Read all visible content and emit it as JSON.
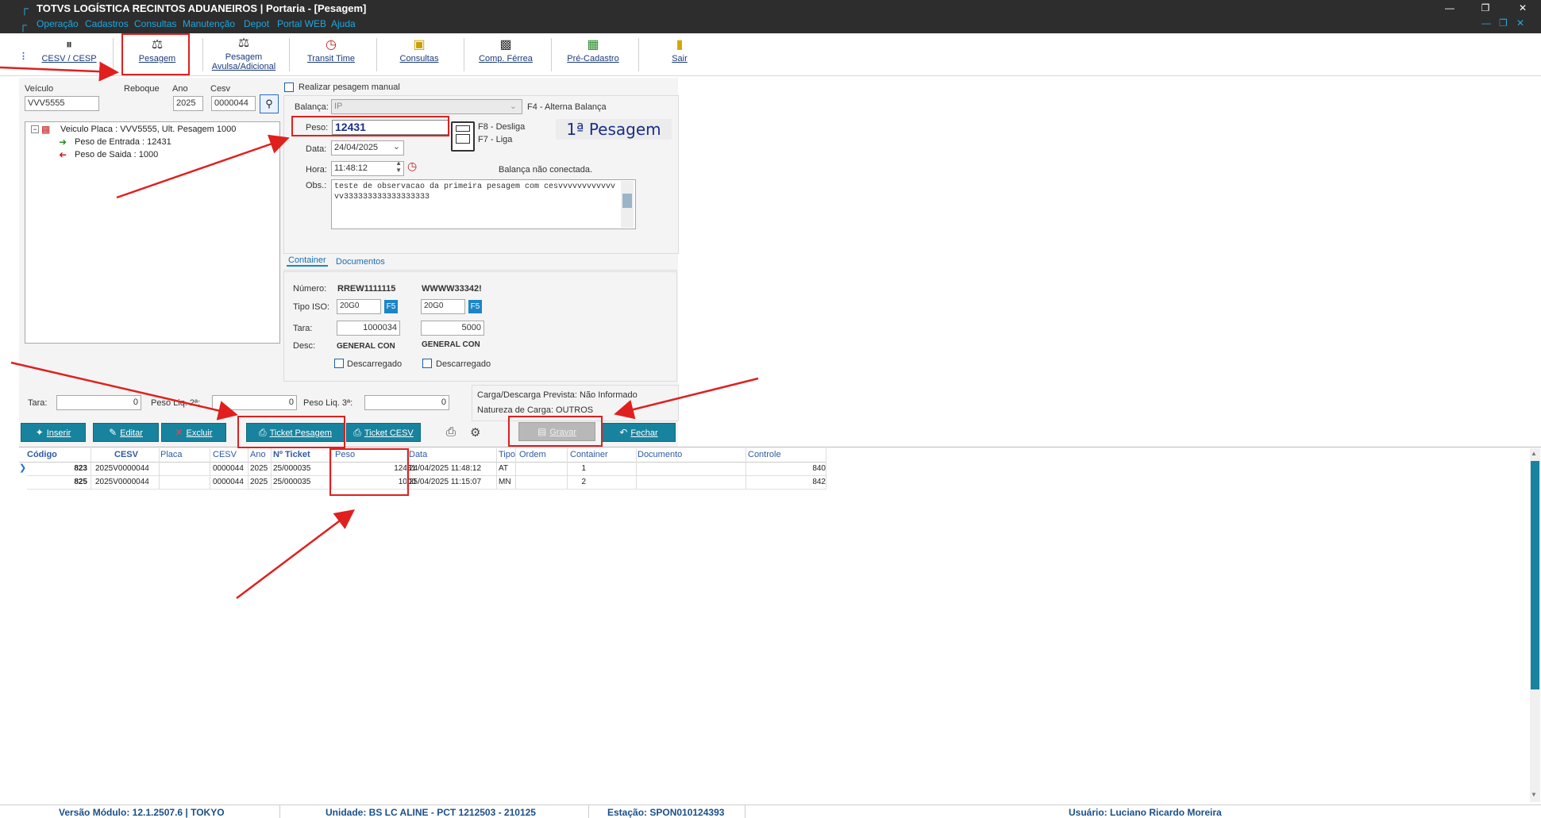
{
  "window": {
    "title": "TOTVS LOGÍSTICA RECINTOS ADUANEIROS | Portaria - [Pesagem]"
  },
  "menu": [
    "Operação",
    "Cadastros",
    "Consultas",
    "Manutenção",
    "Depot",
    "Portal WEB",
    "Ajuda"
  ],
  "toolbar": {
    "cesv": "CESV / CESP",
    "pesagem": "Pesagem",
    "pesagem_avulsa_1": "Pesagem",
    "pesagem_avulsa_2": "Avulsa/Adicional",
    "transit": "Transit Time",
    "consultas": "Consultas",
    "comp_ferrea": "Comp. Férrea",
    "pre_cadastro": "Pré-Cadastro",
    "sair": "Sair"
  },
  "search": {
    "veiculo_label": "Veículo",
    "veiculo_value": "VVV5555",
    "reboque_label": "Reboque",
    "ano_label": "Ano",
    "ano_value": "2025",
    "cesv_label": "Cesv",
    "cesv_value": "0000044"
  },
  "tree": {
    "root": "Veiculo Placa : VVV5555, Ult. Pesagem 1000",
    "entrada": "Peso de Entrada : 12431",
    "saida": "Peso de Saida : 1000"
  },
  "form": {
    "manual_label": "Realizar pesagem manual",
    "balanca_label": "Balança:",
    "balanca_value": "IP",
    "f4_hint": "F4 - Alterna Balança",
    "peso_label": "Peso:",
    "peso_value": "12431",
    "f8_hint": "F8 - Desliga",
    "f7_hint": "F7 - Liga",
    "pesagem_badge": "1ª Pesagem",
    "data_label": "Data:",
    "data_value": "24/04/2025",
    "hora_label": "Hora:",
    "hora_value": "11:48:12",
    "balanca_status": "Balança não conectada.",
    "obs_label": "Obs.:",
    "obs_value": "teste de observacao da primeira pesagem com cesvvvvvvvvvvvvvv333333333333333333"
  },
  "tabs": [
    "Container",
    "Documentos"
  ],
  "container": {
    "numero_label": "Número:",
    "tipo_label": "Tipo ISO:",
    "tara_label": "Tara:",
    "desc_label": "Desc:",
    "c1": {
      "numero": "RREW1111115",
      "tipo": "20G0",
      "f5": "F5",
      "tara": "1000034",
      "desc": "GENERAL CON",
      "descarregado": "Descarregado"
    },
    "c2": {
      "numero": "WWWW33342!",
      "tipo": "20G0",
      "f5": "F5",
      "tara": "5000",
      "desc": "GENERAL CON",
      "descarregado": "Descarregado"
    }
  },
  "tara_row": {
    "tara_label": "Tara:",
    "tara_value": "0",
    "peso2_label": "Peso Liq. 2ª:",
    "peso2_value": "0",
    "peso3_label": "Peso Liq. 3ª:",
    "peso3_value": "0"
  },
  "carga": {
    "prevista": "Carga/Descarga Prevista: Não Informado",
    "natureza": "Natureza de Carga: OUTROS"
  },
  "buttons": {
    "inserir": "Inserir",
    "editar": "Editar",
    "excluir": "Excluir",
    "ticket_pesagem": "Ticket Pesagem",
    "ticket_cesv": "Ticket CESV",
    "gravar": "Gravar",
    "fechar": "Fechar"
  },
  "grid": {
    "headers": [
      "Código",
      "CESV",
      "Placa",
      "CESV",
      "Ano",
      "Nº Ticket",
      "Peso",
      "Data",
      "Tipo",
      "Ordem",
      "Container",
      "Documento",
      "Controle"
    ],
    "rows": [
      [
        "823",
        "2025V0000044",
        "",
        "0000044",
        "2025",
        "25/000035",
        "12431",
        "24/04/2025 11:48:12",
        "AT",
        "1",
        "",
        "",
        "840"
      ],
      [
        "825",
        "2025V0000044",
        "",
        "0000044",
        "2025",
        "25/000035",
        "1000",
        "25/04/2025 11:15:07",
        "MN",
        "2",
        "",
        "",
        "842"
      ]
    ]
  },
  "status": {
    "versao": "Versão Módulo:  12.1.2507.6  |  TOKYO",
    "unidade": "Unidade: BS LC ALINE - PCT 1212503 - 210125",
    "estacao": "Estação: SPON010124393",
    "usuario": "Usuário: Luciano Ricardo Moreira"
  },
  "colors": {
    "accent": "#17839e",
    "annotation": "#e0201e",
    "titlebar": "#2d2d2d"
  }
}
